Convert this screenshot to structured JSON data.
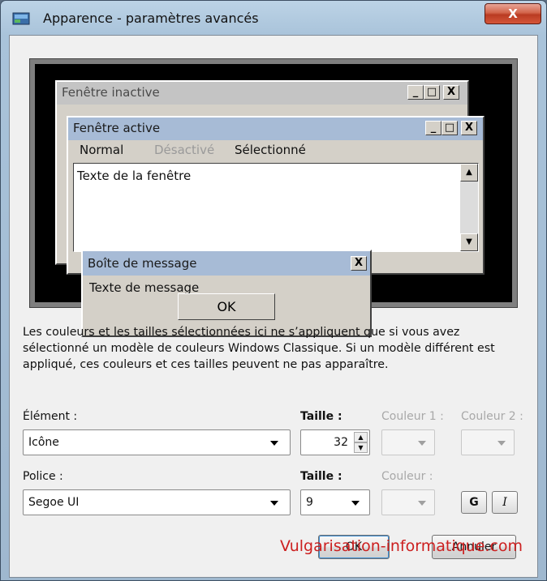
{
  "window": {
    "title": "Apparence - paramètres avancés",
    "close_label": "X"
  },
  "preview": {
    "inactive_title": "Fenêtre inactive",
    "active_title": "Fenêtre active",
    "menu": {
      "normal": "Normal",
      "disabled": "Désactivé",
      "selected": "Sélectionné"
    },
    "window_text": "Texte de la fenêtre",
    "message_title": "Boîte de message",
    "message_text": "Texte de message",
    "ok_label": "OK",
    "win_buttons": [
      "_",
      "□",
      "X"
    ]
  },
  "info_text": "Les couleurs et les tailles sélectionnées ici ne s’appliquent que si vous avez sélectionné un modèle de couleurs Windows Classique. Si un modèle différent est appliqué, ces couleurs et ces tailles peuvent ne pas apparaître.",
  "element": {
    "label": "Élément :",
    "value": "Icône",
    "size_label": "Taille :",
    "size_value": "32",
    "color1_label": "Couleur 1 :",
    "color2_label": "Couleur 2 :"
  },
  "font": {
    "label": "Police :",
    "value": "Segoe UI",
    "size_label": "Taille :",
    "size_value": "9",
    "color_label": "Couleur :",
    "bold_label": "G",
    "italic_label": "I"
  },
  "buttons": {
    "ok": "OK",
    "cancel": "Annuler"
  },
  "watermark": "Vulgarisation-informatique.com",
  "colors": {
    "active_title": "#a7bbd6",
    "inactive_title": "#c4c4c4",
    "close": "#c94a2e",
    "watermark": "#cc1f1f"
  }
}
